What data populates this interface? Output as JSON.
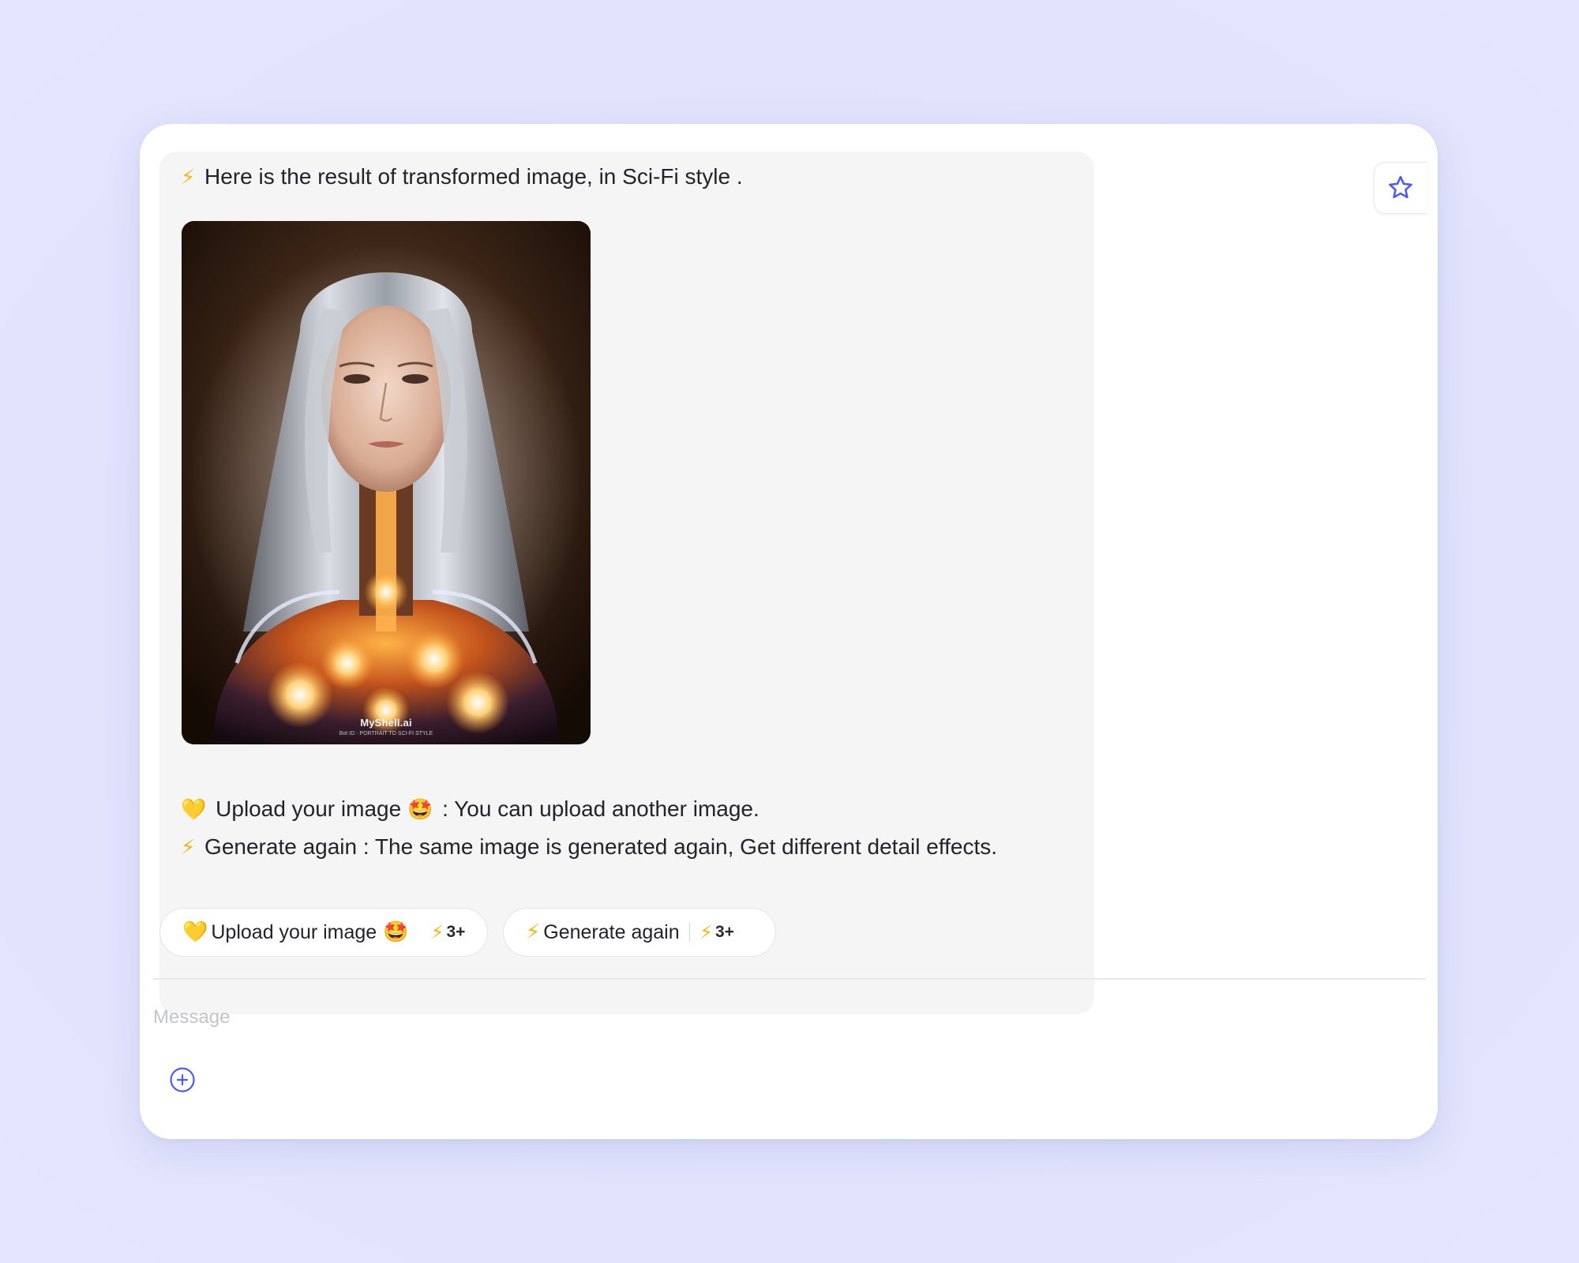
{
  "message": {
    "result_line": "Here is the result of transformed image, in Sci-Fi style .",
    "upload_line_label": "Upload your image",
    "upload_line_desc": ": You can upload another image.",
    "generate_line": "Generate again : The same image is generated again, Get different detail effects.",
    "image": {
      "watermark_brand": "MyShell.ai",
      "watermark_sub": "Bot ID · PORTRAIT TO SCI-FI STYLE"
    }
  },
  "icons": {
    "bolt": "⚡",
    "yellow_heart": "💛",
    "star_struck": "🤩",
    "favorite": "star-outline-icon",
    "attach": "plus-circle-icon"
  },
  "actions": [
    {
      "label": "Upload your image",
      "cost": "3+"
    },
    {
      "label": "Generate again",
      "cost": "3+"
    }
  ],
  "composer": {
    "placeholder": "e a Message"
  },
  "colors": {
    "accent": "#4b5bf0",
    "background": "#e1e3fc",
    "bubble": "#f5f5f5",
    "bolt": "#f5b31b"
  }
}
